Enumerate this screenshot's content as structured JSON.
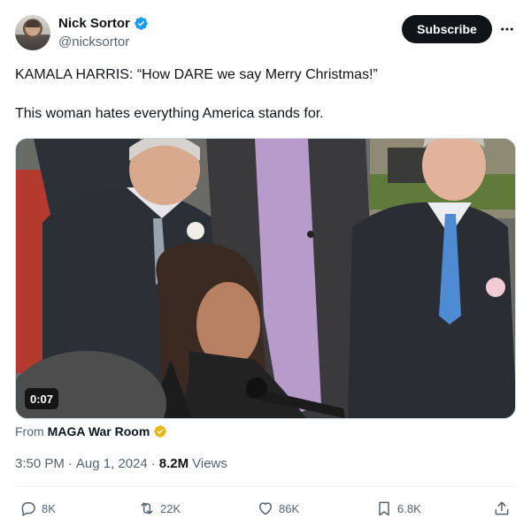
{
  "author": {
    "display_name": "Nick Sortor",
    "handle": "@nicksortor"
  },
  "header": {
    "subscribe_label": "Subscribe",
    "more_label": "···"
  },
  "tweet": {
    "line1": "KAMALA HARRIS: “How DARE we say Merry Christmas!”",
    "line2": "This woman hates everything America stands for."
  },
  "media": {
    "duration": "0:07"
  },
  "attribution": {
    "prefix": "From",
    "source_name": "MAGA War Room"
  },
  "meta": {
    "time": "3:50 PM",
    "separator1": "·",
    "date": "Aug 1, 2024",
    "separator2": "·",
    "views_count": "8.2M",
    "views_label": "Views"
  },
  "actions": {
    "replies": "8K",
    "reposts": "22K",
    "likes": "86K",
    "bookmarks": "6.8K"
  },
  "icons": {
    "verified": "verified-badge-icon",
    "gold_check": "gold-verified-icon",
    "reply": "reply-icon",
    "repost": "repost-icon",
    "like": "heart-icon",
    "bookmark": "bookmark-icon",
    "share": "share-icon",
    "more": "more-dots-icon"
  },
  "colors": {
    "text_primary": "#0f1419",
    "text_secondary": "#536471",
    "verified_blue": "#1d9bf0",
    "gold": "#e2b719",
    "button_dark": "#0f1419",
    "divider": "#eff3f4"
  }
}
